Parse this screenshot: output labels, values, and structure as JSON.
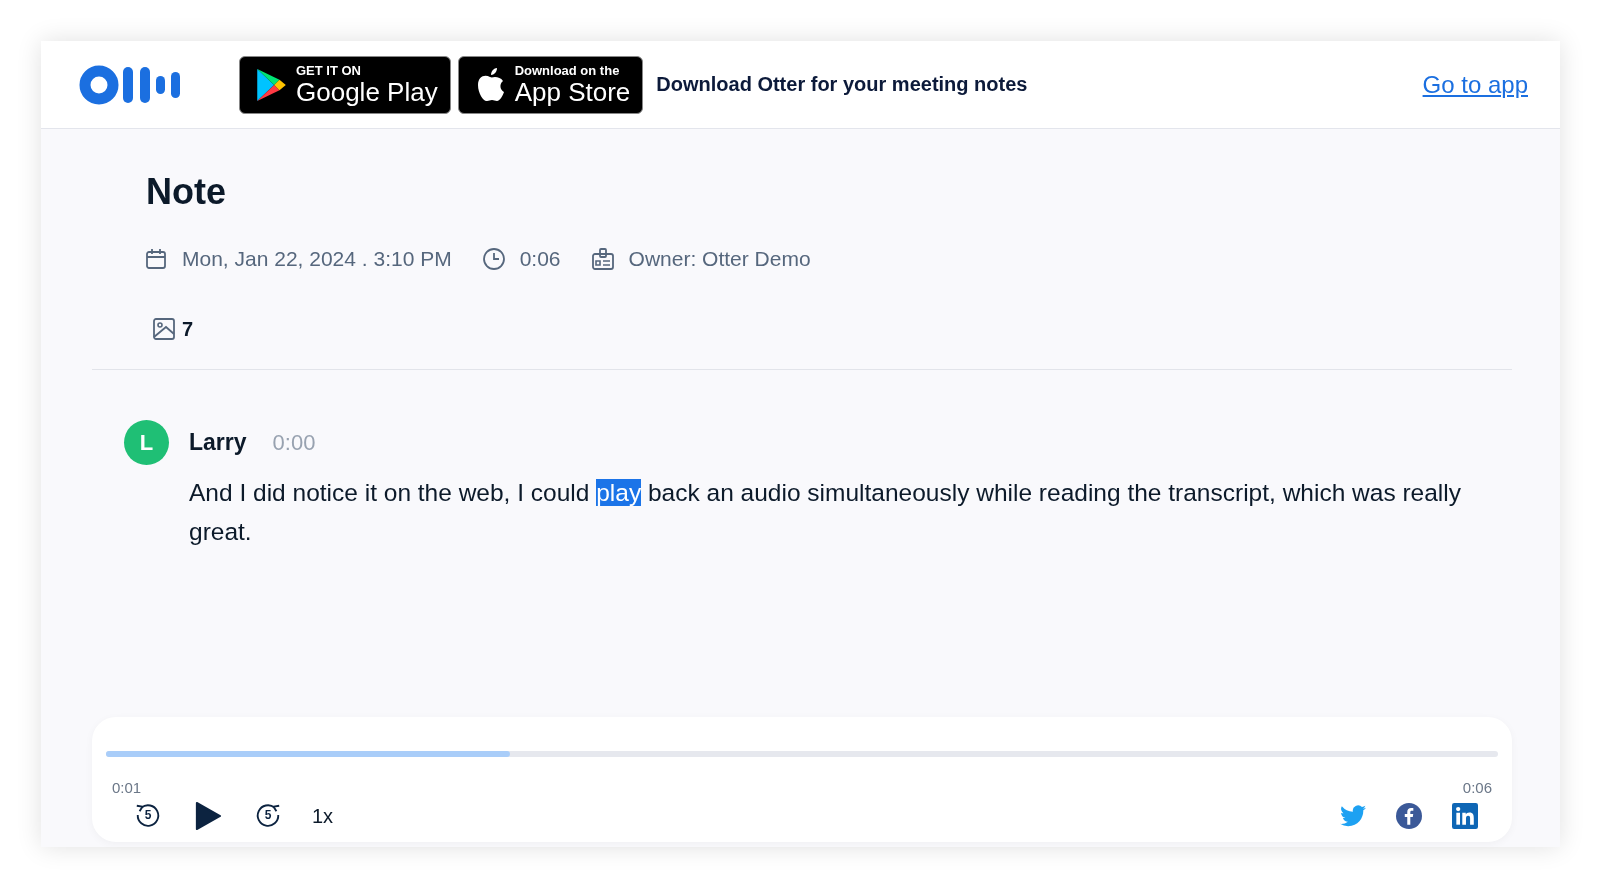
{
  "header": {
    "google_play": {
      "top": "GET IT ON",
      "bottom": "Google Play"
    },
    "app_store": {
      "top": "Download on the",
      "bottom": "App Store"
    },
    "tagline": "Download Otter for your meeting notes",
    "link": "Go to app"
  },
  "note": {
    "title": "Note",
    "date": "Mon, Jan 22, 2024 . 3:10 PM",
    "duration": "0:06",
    "owner": "Owner: Otter Demo",
    "image_count": "7"
  },
  "transcript": [
    {
      "avatar": "L",
      "color": "#1fbf75",
      "speaker": "Larry",
      "time": "0:00",
      "segments": [
        {
          "text": "And I did notice it on the web, I could ",
          "selected": false
        },
        {
          "text": "play",
          "selected": true
        },
        {
          "text": " back an audio simultaneously while reading the transcript, which was really great.",
          "selected": false
        }
      ]
    }
  ],
  "player": {
    "level": 0.29,
    "current": "0:01",
    "total": "0:06",
    "speed": "1x",
    "back_seconds": "5",
    "forward_seconds": "5"
  }
}
